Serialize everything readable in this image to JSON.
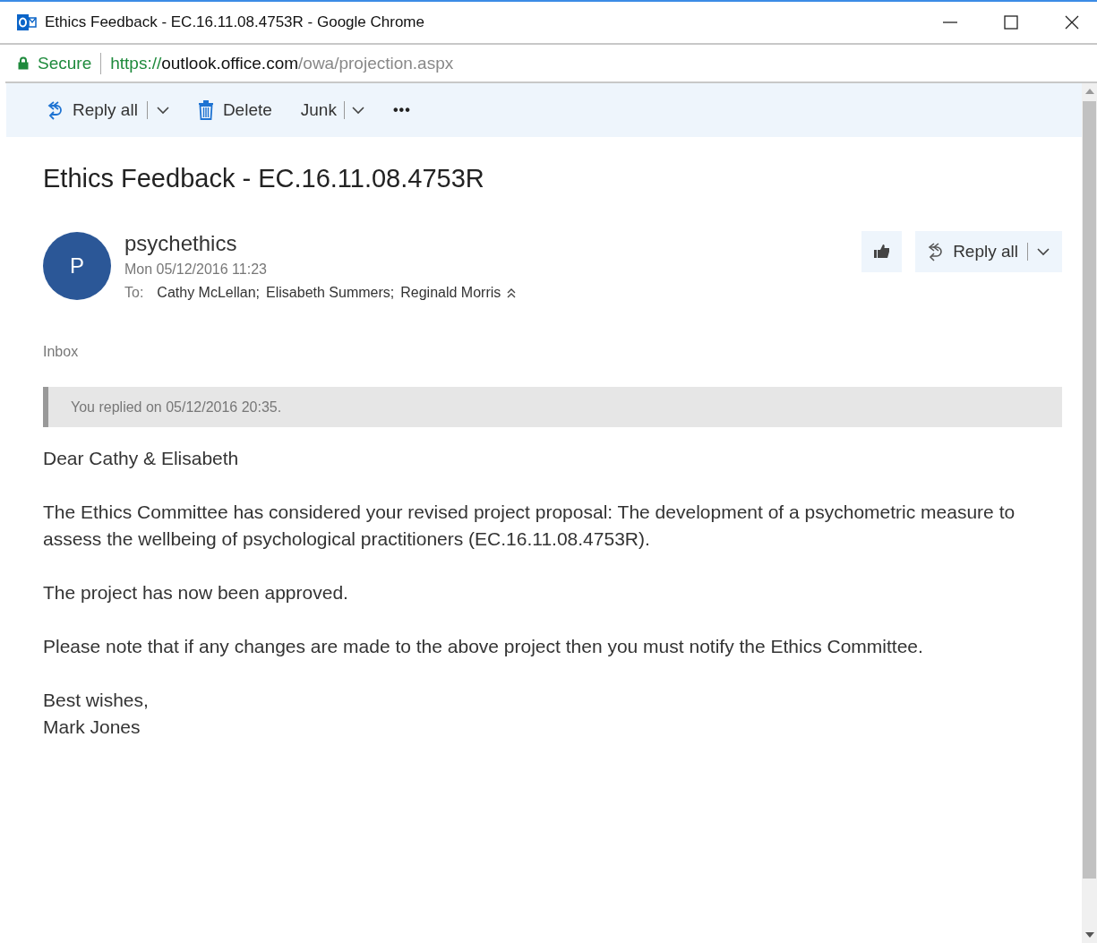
{
  "window": {
    "title": "Ethics Feedback - EC.16.11.08.4753R - Google Chrome"
  },
  "address_bar": {
    "security": "Secure",
    "url_scheme": "https://",
    "url_host": "outlook.office.com",
    "url_path": "/owa/projection.aspx"
  },
  "toolbar": [
    {
      "kind": "reply",
      "label": "Reply all",
      "dropdown": true
    },
    {
      "kind": "delete",
      "label": "Delete",
      "dropdown": false
    },
    {
      "kind": "junk",
      "label": "Junk",
      "dropdown": true
    },
    {
      "kind": "more",
      "label": "•••",
      "dropdown": false
    }
  ],
  "message": {
    "subject": "Ethics Feedback - EC.16.11.08.4753R",
    "avatar": "P",
    "sender": "psychethics",
    "date": "Mon 05/12/2016 11:23",
    "to_label": "To:",
    "recipients": [
      "Cathy McLellan;",
      "Elisabeth Summers;",
      "Reginald Morris"
    ],
    "reply_all": "Reply all",
    "folder": "Inbox",
    "notice": "You replied on 05/12/2016 20:35.",
    "body": [
      "Dear Cathy & Elisabeth",
      "The Ethics Committee has considered your revised project proposal: The development of a psychometric measure to assess the wellbeing of psychological practitioners (EC.16.11.08.4753R).",
      "The project has now been approved.",
      "Please note that if any changes are made to the above project then you must notify the Ethics Committee."
    ],
    "signature": [
      "Best wishes,",
      "Mark Jones"
    ]
  }
}
